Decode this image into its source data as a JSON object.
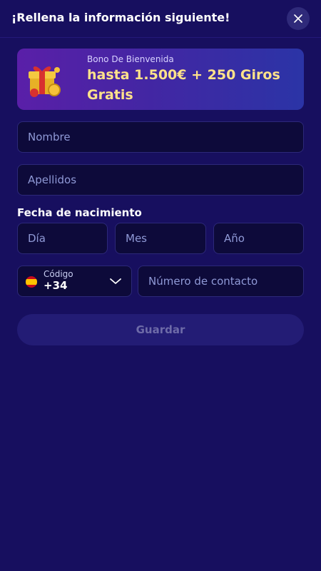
{
  "header": {
    "title": "¡Rellena la información siguiente!",
    "close_icon": "close-icon"
  },
  "banner": {
    "icon": "gift-box-icon",
    "subtitle": "Bono De Bienvenida",
    "headline": "hasta 1.500€ + 250 Giros Gratis",
    "headline_color": "#ffe28a"
  },
  "form": {
    "first_name_placeholder": "Nombre",
    "last_name_placeholder": "Apellidos",
    "dob": {
      "label": "Fecha de nacimiento",
      "day_placeholder": "Día",
      "month_placeholder": "Mes",
      "year_placeholder": "Año"
    },
    "phone": {
      "code_label": "Código",
      "code_value": "+34",
      "flag_icon": "spain-flag-icon",
      "number_placeholder": "Número de contacto"
    },
    "save_label": "Guardar"
  },
  "colors": {
    "background": "#170f5f",
    "field_background": "#0d0a3a",
    "placeholder": "#8f99d6",
    "button_disabled": "#231c75"
  }
}
